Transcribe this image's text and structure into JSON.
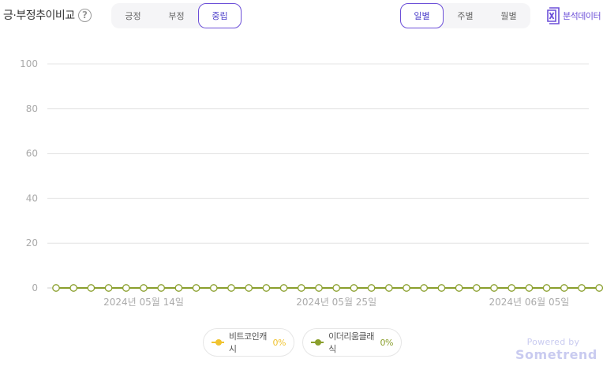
{
  "header": {
    "title": "긍·부정추이비교",
    "help_icon": "question-circle-icon",
    "sentiment_tabs": [
      "긍정",
      "부정",
      "중립"
    ],
    "sentiment_selected": "중립",
    "period_tabs": [
      "일별",
      "주별",
      "월별"
    ],
    "period_selected": "일별",
    "export_label": "분석데이터",
    "export_icon": "excel-icon"
  },
  "colors": {
    "accent": "#6c4fd8",
    "series1": "#f0c330",
    "series2": "#8a9f2c",
    "grid": "#e4e4e4"
  },
  "chart_data": {
    "type": "line",
    "ylim": [
      0,
      100
    ],
    "yticks": [
      0,
      20,
      40,
      60,
      80,
      100
    ],
    "x": [
      "2024-05-09",
      "2024-05-10",
      "2024-05-11",
      "2024-05-12",
      "2024-05-13",
      "2024-05-14",
      "2024-05-15",
      "2024-05-16",
      "2024-05-17",
      "2024-05-18",
      "2024-05-19",
      "2024-05-20",
      "2024-05-21",
      "2024-05-22",
      "2024-05-23",
      "2024-05-24",
      "2024-05-25",
      "2024-05-26",
      "2024-05-27",
      "2024-05-28",
      "2024-05-29",
      "2024-05-30",
      "2024-05-31",
      "2024-06-01",
      "2024-06-02",
      "2024-06-03",
      "2024-06-04",
      "2024-06-05",
      "2024-06-06",
      "2024-06-07",
      "2024-06-08",
      "2024-06-09",
      "2024-06-10",
      "2024-06-11",
      "2024-06-12",
      "2024-06-13",
      "2024-06-14",
      "2024-06-15",
      "2024-06-16",
      "2024-06-17"
    ],
    "xtick_labels": [
      {
        "date": "2024-05-14",
        "label": "2024년 05월 14일"
      },
      {
        "date": "2024-05-25",
        "label": "2024년 05월 25일"
      },
      {
        "date": "2024-06-05",
        "label": "2024년 06월 05일"
      }
    ],
    "series": [
      {
        "name": "비트코인캐시",
        "color": "#f0c330",
        "values": [
          0,
          0,
          0,
          0,
          0,
          0,
          0,
          0,
          0,
          0,
          0,
          0,
          0,
          0,
          0,
          0,
          0,
          0,
          0,
          0,
          0,
          0,
          0,
          0,
          0,
          0,
          0,
          0,
          0,
          0,
          0,
          0,
          0,
          0,
          0,
          0,
          0,
          0,
          0,
          0
        ]
      },
      {
        "name": "이더리움클래식",
        "color": "#8a9f2c",
        "values": [
          0,
          0,
          0,
          0,
          0,
          0,
          0,
          0,
          0,
          0,
          0,
          0,
          0,
          0,
          0,
          0,
          0,
          0,
          0,
          0,
          0,
          0,
          0,
          0,
          0,
          0,
          0,
          0,
          0,
          0,
          0,
          0,
          0,
          0,
          0,
          0,
          0,
          0,
          0,
          0
        ]
      }
    ]
  },
  "legend": [
    {
      "name": "비트코인캐시",
      "pct": "0%",
      "color": "#f0c330"
    },
    {
      "name": "이더리움클래식",
      "pct": "0%",
      "color": "#8a9f2c"
    }
  ],
  "footer": {
    "powered_by": "Powered by",
    "brand": "Sometrend"
  }
}
